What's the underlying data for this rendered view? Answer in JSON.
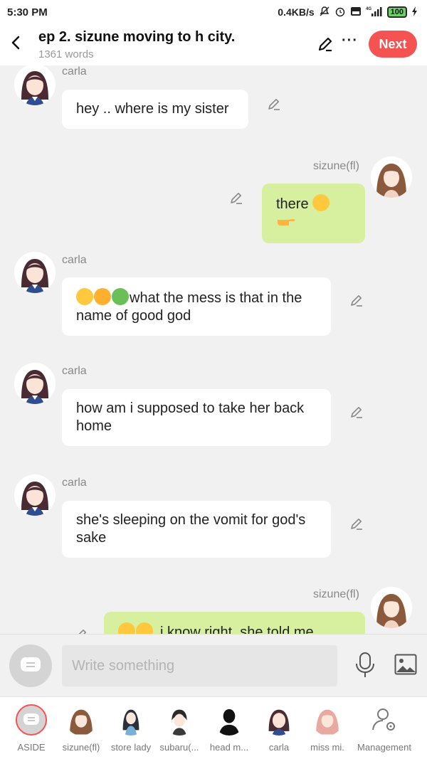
{
  "status": {
    "time": "5:30 PM",
    "network_speed": "0.4KB/s",
    "battery": "100",
    "network": "4G"
  },
  "header": {
    "title": "ep 2. sizune moving to h city.",
    "word_count": "1361 words",
    "next_label": "Next"
  },
  "messages": [
    {
      "speaker": "carla",
      "side": "left",
      "text": "hey .. where is my sister",
      "emojis": []
    },
    {
      "speaker": "sizune(fl)",
      "side": "right",
      "text": "there",
      "emojis_after": [
        "smiling-face-emoji",
        "pointing-hand-emoji"
      ]
    },
    {
      "speaker": "carla",
      "side": "left",
      "text": "what the mess is that in the name of good god",
      "emojis": [
        "fearful-face-emoji",
        "dizzy-face-emoji",
        "nauseated-face-emoji"
      ]
    },
    {
      "speaker": "carla",
      "side": "left",
      "text": "how am i supposed to take her back home",
      "emojis": []
    },
    {
      "speaker": "carla",
      "side": "left",
      "text": "she's sleeping on the vomit for god's sake",
      "emojis": []
    },
    {
      "speaker": "sizune(fl)",
      "side": "right",
      "text": "i know right, she told me",
      "emojis": [
        "laughing-face-emoji",
        "laughing-face-emoji"
      ]
    }
  ],
  "composer": {
    "placeholder": "Write something"
  },
  "characters": [
    {
      "label": "ASIDE"
    },
    {
      "label": "sizune(fl)"
    },
    {
      "label": "store lady"
    },
    {
      "label": "subaru(..."
    },
    {
      "label": "head m..."
    },
    {
      "label": "carla"
    },
    {
      "label": "miss mi."
    },
    {
      "label": "Management"
    }
  ],
  "colors": {
    "accent": "#f55252",
    "my_bubble": "#d6f0a0",
    "other_bubble": "#ffffff",
    "background": "#f1f1f1"
  }
}
